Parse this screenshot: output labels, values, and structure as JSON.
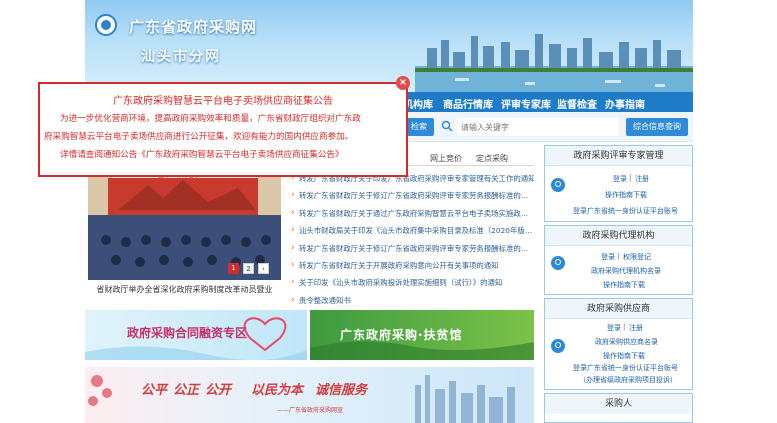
{
  "header": {
    "title": "广东省政府采购网",
    "subtitle": "汕头市分网"
  },
  "nav": {
    "items": [
      "机构库",
      "商品行情库",
      "评审专家库",
      "监督检查",
      "办事指南"
    ]
  },
  "search": {
    "left_button": "检索",
    "placeholder": "请输入关键字",
    "button": "综合信息查询"
  },
  "news": {
    "tabs": [
      "网上竞价",
      "定点采购"
    ],
    "items": [
      "转发广东省财政厅关于印发广东省政府采购评审专家管理有关工作的通知",
      "转发广东省财政厅关于修订广东省政府采购评审专家劳务报酬标准的…",
      "转发广东省财政厅关于通过广东政府采购智慧云平台电子卖场实施政…",
      "汕头市财政局关于印发《汕头市政府集中采购目录及标准（2020年版…",
      "转发广东省财政厅关于修订广东省政府采购评审专家劳务报酬标准的…",
      "转发广东省财政厅关于开展政府采购意向公开有关事项的通知",
      "关于印发《汕头市政府采购投诉处理实施细则（试行）》的通知",
      "责令整改通知书"
    ]
  },
  "slider": {
    "caption": "省财政厅举办全省深化政府采购制度改革动员暨业",
    "photo_text": "整体工作部署会",
    "dots": [
      "1",
      "2",
      "›"
    ]
  },
  "banners": {
    "finance": "政府采购合同融资专区",
    "poverty": "广东政府采购·扶贫馆",
    "slogan_words": [
      "公平",
      "公正",
      "公开",
      "以民为本",
      "诚信服务"
    ],
    "slogan_sub": "——广东省政府采购网宣"
  },
  "sidebar": {
    "panels": [
      {
        "title": "政府采购评审专家管理",
        "links": [
          "登录",
          "注册"
        ],
        "extra": [
          "操作指南下载",
          "登录广东省统一身份认证平台账号"
        ]
      },
      {
        "title": "政府采购代理机构",
        "links": [
          "登录",
          "权限登记"
        ],
        "extra": [
          "政府采购代理机构名录",
          "操作指南下载"
        ]
      },
      {
        "title": "政府采购供应商",
        "links": [
          "登录",
          "注册"
        ],
        "extra": [
          "政府采购供应商名录",
          "操作指南下载",
          "登录广东省统一身份认证平台账号",
          "（办理省级政府采购项目投诉）"
        ]
      },
      {
        "title": "采购人",
        "links": [],
        "extra": []
      }
    ]
  },
  "popup": {
    "title": "广东政府采购智慧云平台电子卖场供应商征集公告",
    "lines": [
      "为进一步优化营商环境，提高政府采购效率和质量，广东省财政厅组织对广东政",
      "府采购智慧云平台电子卖场供应商进行公开征集，欢迎有能力的国内供应商参加。",
      "详情请查阅通知公告《广东政府采购智慧云平台电子卖场供应商征集公告》"
    ],
    "close": "×"
  },
  "colors": {
    "nav": "#1e7cc7",
    "popup_red": "#d42b2b",
    "link_blue": "#1c5fa3"
  }
}
